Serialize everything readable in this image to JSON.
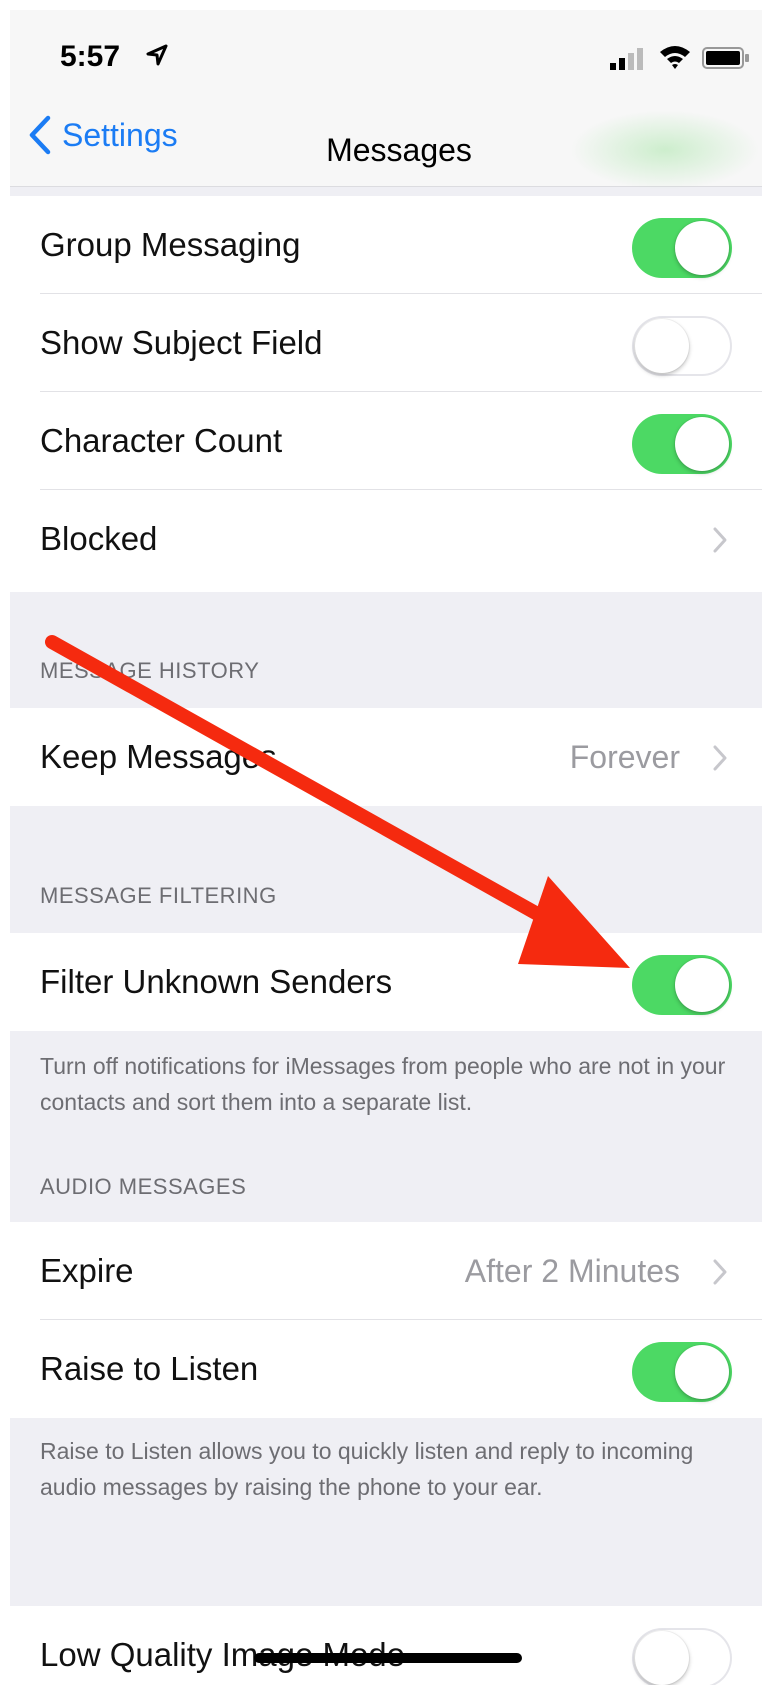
{
  "status_bar": {
    "time": "5:57"
  },
  "nav": {
    "back_label": "Settings",
    "title": "Messages"
  },
  "rows_top": [
    {
      "label": "Group Messaging",
      "toggle": true
    },
    {
      "label": "Show Subject Field",
      "toggle": false
    },
    {
      "label": "Character Count",
      "toggle": true
    },
    {
      "label": "Blocked"
    }
  ],
  "message_history": {
    "header": "MESSAGE HISTORY",
    "keep_messages": {
      "label": "Keep Messages",
      "value": "Forever"
    }
  },
  "message_filtering": {
    "header": "MESSAGE FILTERING",
    "filter_unknown": {
      "label": "Filter Unknown Senders",
      "toggle": true
    },
    "footer": "Turn off notifications for iMessages from people who are not in your contacts and sort them into a separate list."
  },
  "audio_messages": {
    "header": "AUDIO MESSAGES",
    "expire": {
      "label": "Expire",
      "value": "After 2 Minutes"
    },
    "raise_to_listen": {
      "label": "Raise to Listen",
      "toggle": true
    },
    "footer": "Raise to Listen allows you to quickly listen and reply to incoming audio messages by raising the phone to your ear."
  },
  "low_quality": {
    "label": "Low Quality Image Mode",
    "toggle": false
  },
  "colors": {
    "toggle_on": "#4cd964",
    "link_blue": "#1b7cf4",
    "annotation_arrow": "#f52a0f"
  }
}
